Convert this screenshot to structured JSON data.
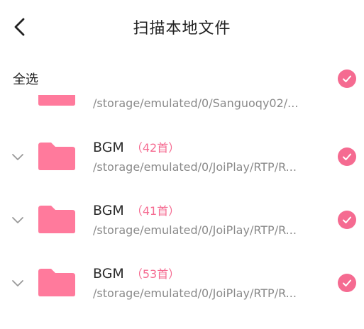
{
  "header": {
    "title": "扫描本地文件"
  },
  "select_all": {
    "label": "全选",
    "checked": true
  },
  "colors": {
    "accent": "#f56b91",
    "folder": "#ff7a9c",
    "text": "#2b2b2b",
    "secondary": "#8a8a8a"
  },
  "folders": [
    {
      "name": "",
      "count": "",
      "path": "/storage/emulated/0/Sanguoqy02/...",
      "checked": true
    },
    {
      "name": "BGM",
      "count": "（42首）",
      "path": "/storage/emulated/0/JoiPlay/RTP/R...",
      "checked": true
    },
    {
      "name": "BGM",
      "count": "（41首）",
      "path": "/storage/emulated/0/JoiPlay/RTP/R...",
      "checked": true
    },
    {
      "name": "BGM",
      "count": "（53首）",
      "path": "/storage/emulated/0/JoiPlay/RTP/R...",
      "checked": true
    }
  ]
}
